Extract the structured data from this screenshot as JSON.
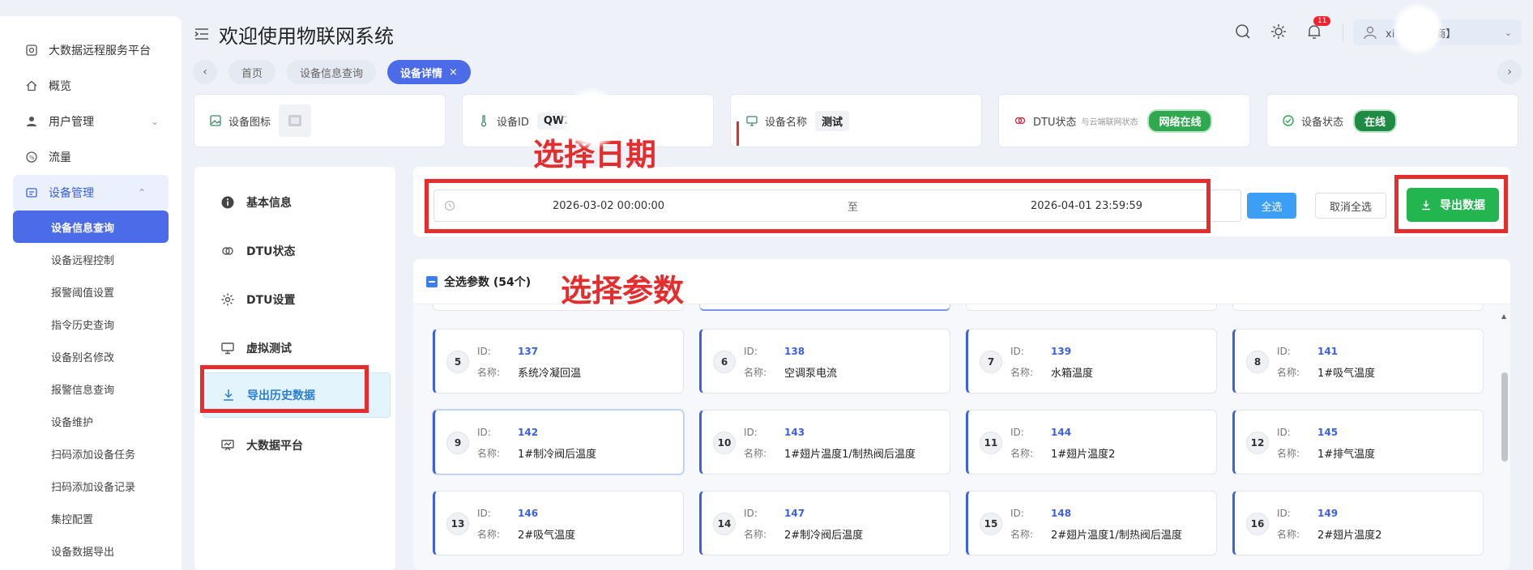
{
  "sidebar": {
    "items": [
      {
        "label": "大数据远程服务平台",
        "icon": "platform-icon"
      },
      {
        "label": "概览",
        "icon": "home-icon"
      },
      {
        "label": "用户管理",
        "icon": "user-icon"
      },
      {
        "label": "流量",
        "icon": "traffic-icon"
      }
    ],
    "device_group": {
      "label": "设备管理",
      "icon": "device-manage-icon"
    },
    "sub_items": [
      {
        "label": "设备信息查询"
      },
      {
        "label": "设备远程控制"
      },
      {
        "label": "报警阈值设置"
      },
      {
        "label": "指令历史查询"
      },
      {
        "label": "设备别名修改"
      },
      {
        "label": "报警信息查询"
      },
      {
        "label": "设备维护"
      },
      {
        "label": "扫码添加设备任务"
      },
      {
        "label": "扫码添加设备记录"
      },
      {
        "label": "集控配置"
      },
      {
        "label": "设备数据导出"
      }
    ]
  },
  "header": {
    "title": "欢迎使用物联网系统",
    "notification_count": "11",
    "user_label": "xi         est【厂商】"
  },
  "tabs": [
    {
      "label": "首页"
    },
    {
      "label": "设备信息查询"
    },
    {
      "label": "设备详情",
      "close": "×"
    }
  ],
  "info": {
    "icon_label": "设备图标",
    "id_label": "设备ID",
    "id_value": "QW2       E",
    "name_label": "设备名称",
    "name_value": "测试",
    "dtu_label": "DTU状态",
    "dtu_sub": "与云端联网状态",
    "dtu_value": "网络在线",
    "status_label": "设备状态",
    "status_value": "在线"
  },
  "leftnav": {
    "items": [
      {
        "label": "基本信息"
      },
      {
        "label": "DTU状态"
      },
      {
        "label": "DTU设置"
      },
      {
        "label": "虚拟测试"
      },
      {
        "label": "导出历史数据"
      },
      {
        "label": "大数据平台"
      }
    ]
  },
  "date_panel": {
    "start": "2026-03-02 00:00:00",
    "separator": "至",
    "end": "2026-04-01 23:59:59",
    "select_all": "全选",
    "cancel_all": "取消全选",
    "export": "导出数据"
  },
  "params": {
    "header": "全选参数 (54个)",
    "id_label": "ID:",
    "name_label": "名称:",
    "cards": [
      {
        "num": "5",
        "id": "137",
        "name": "系统冷凝回温"
      },
      {
        "num": "6",
        "id": "138",
        "name": "空调泵电流"
      },
      {
        "num": "7",
        "id": "139",
        "name": "水箱温度"
      },
      {
        "num": "8",
        "id": "141",
        "name": "1#吸气温度"
      },
      {
        "num": "9",
        "id": "142",
        "name": "1#制冷阀后温度",
        "selected": true
      },
      {
        "num": "10",
        "id": "143",
        "name": "1#翅片温度1/制热阀后温度"
      },
      {
        "num": "11",
        "id": "144",
        "name": "1#翅片温度2"
      },
      {
        "num": "12",
        "id": "145",
        "name": "1#排气温度"
      },
      {
        "num": "13",
        "id": "146",
        "name": "2#吸气温度"
      },
      {
        "num": "14",
        "id": "147",
        "name": "2#制冷阀后温度"
      },
      {
        "num": "15",
        "id": "148",
        "name": "2#翅片温度1/制热阀后温度"
      },
      {
        "num": "16",
        "id": "149",
        "name": "2#翅片温度2"
      }
    ]
  },
  "annotations": {
    "date_label": "选择日期",
    "param_label": "选择参数"
  },
  "colors": {
    "primary": "#4c6be8",
    "annotation_red": "#e52d2d",
    "export_green": "#23b550",
    "select_all_blue": "#3d9ef5"
  }
}
